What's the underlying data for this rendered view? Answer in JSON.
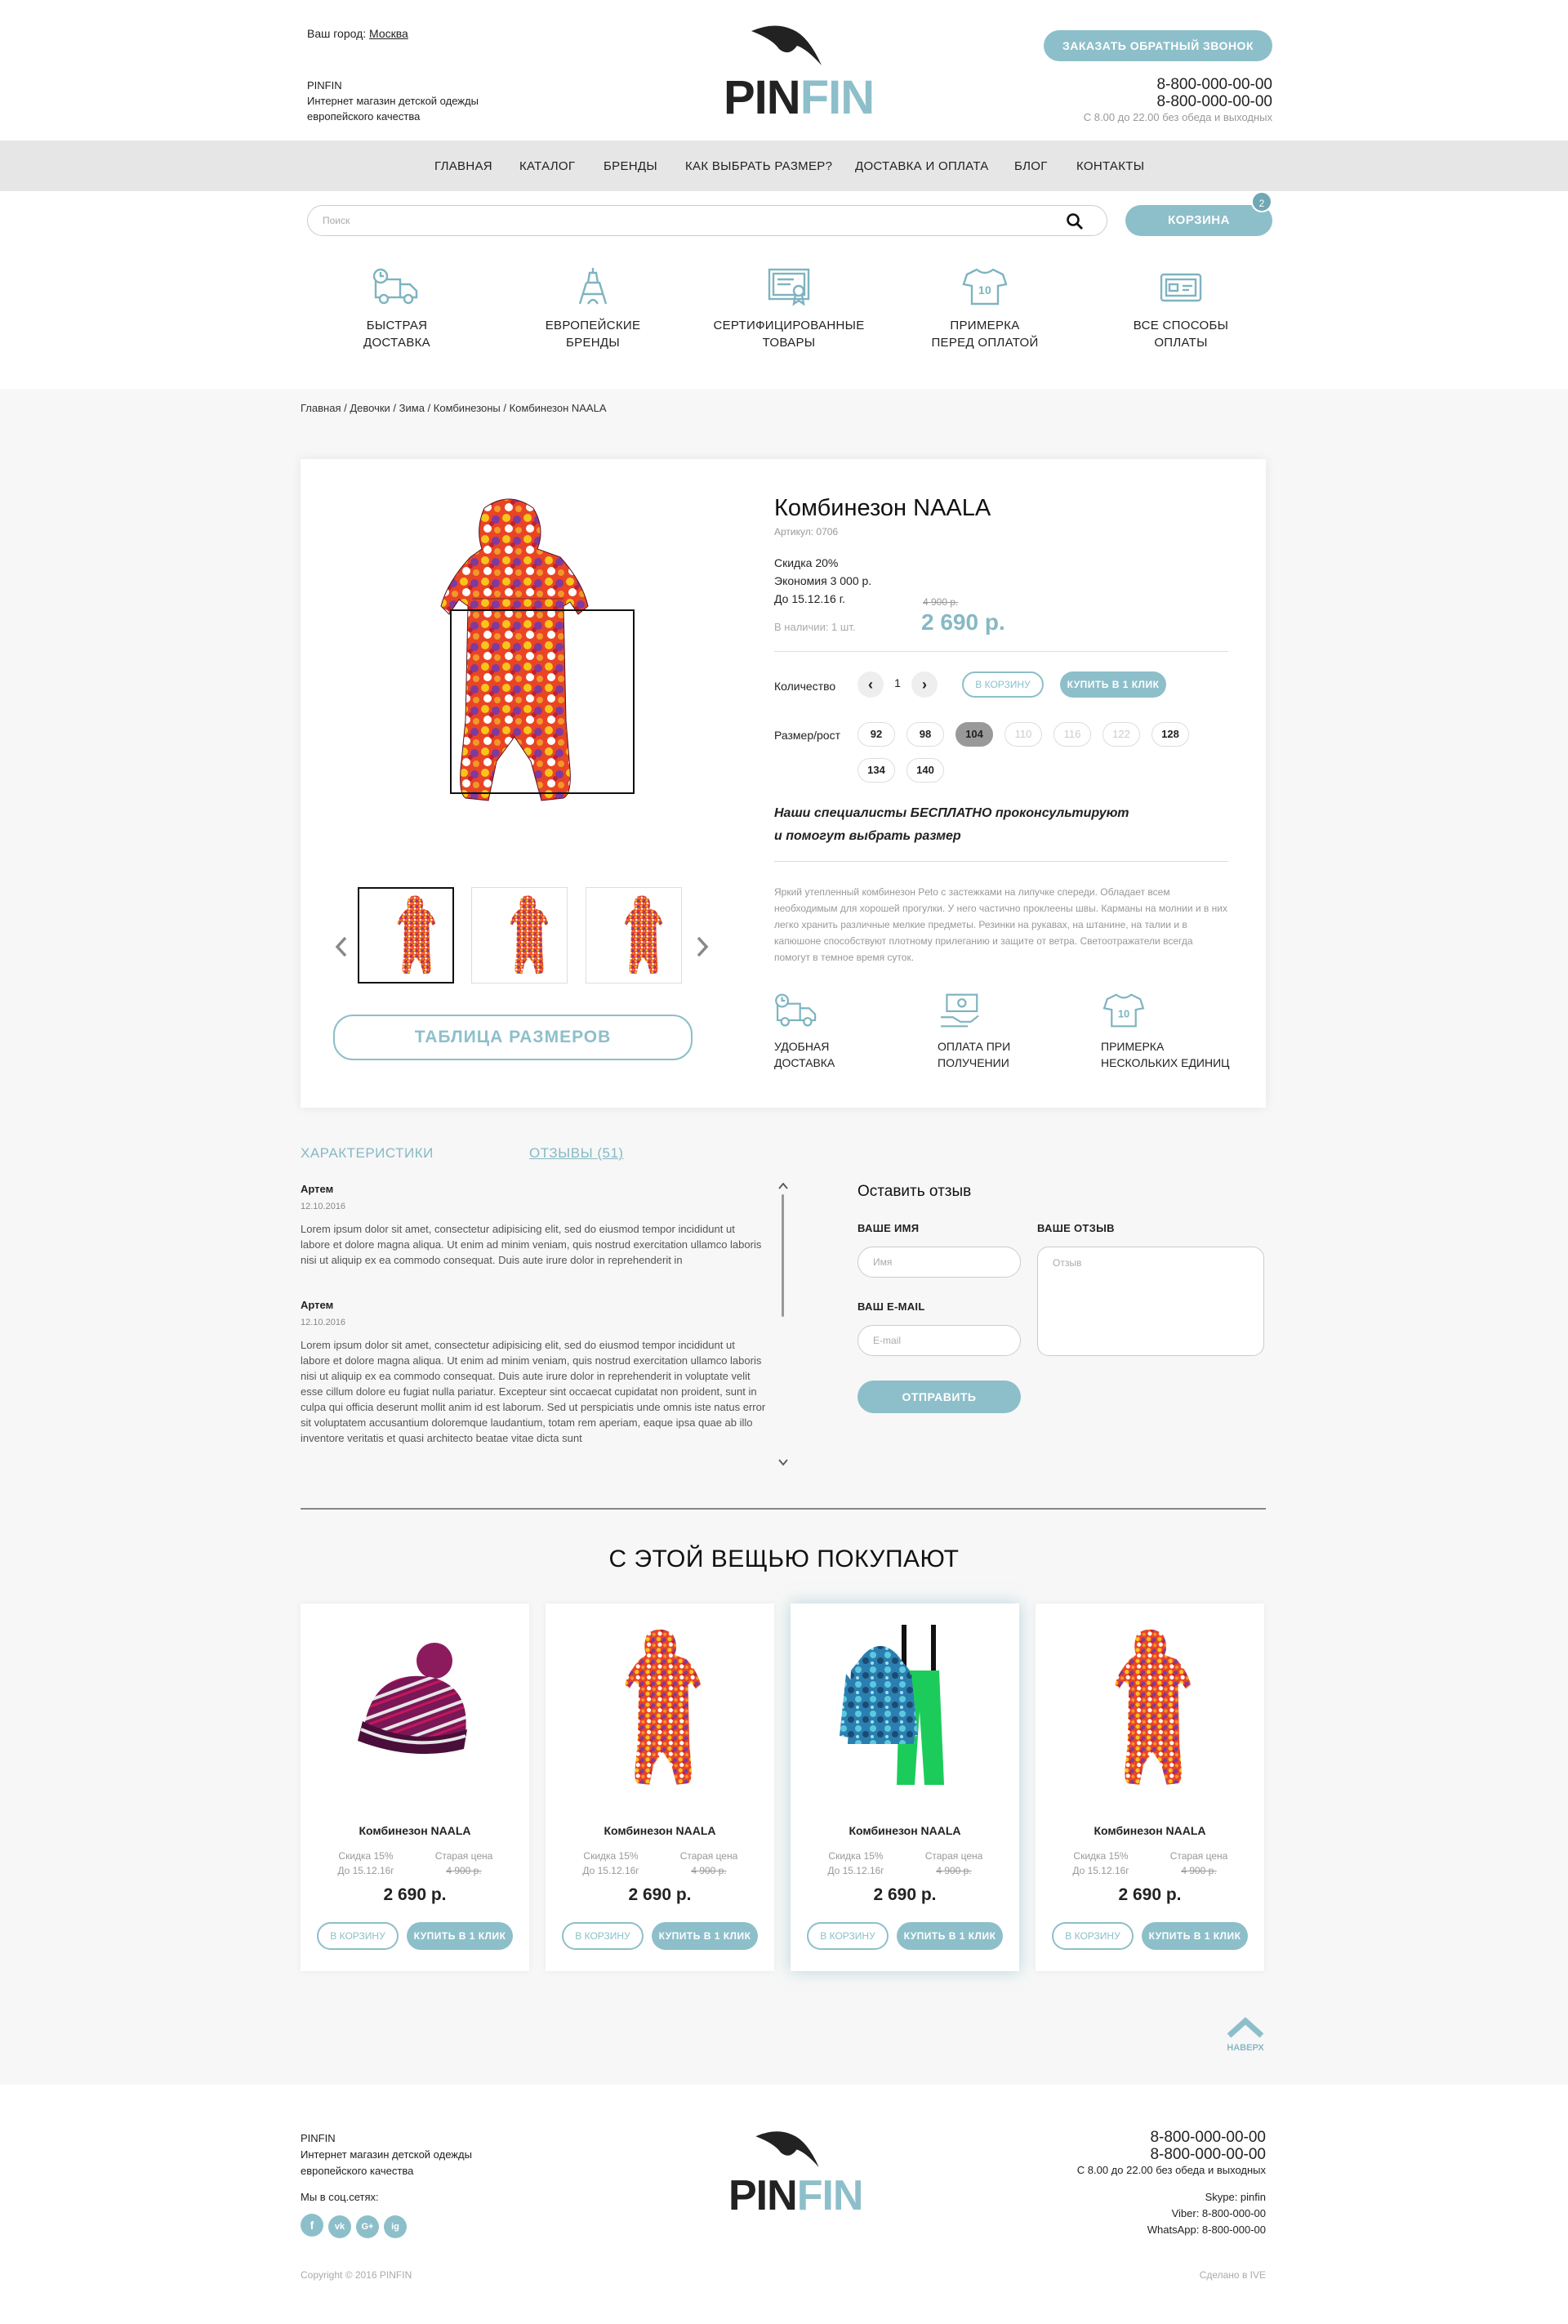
{
  "header": {
    "city_label": "Ваш город:",
    "city": "Москва",
    "brand": "PINFIN",
    "tagline_1": "Интернет магазин детской одежды",
    "tagline_2": "европейского качества",
    "logo_pin": "PIN",
    "logo_fin": "FIN",
    "callback_button": "ЗАКАЗАТЬ ОБРАТНЫЙ ЗВОНОК",
    "phone_1": "8-800-000-00-00",
    "phone_2": "8-800-000-00-00",
    "hours": "С 8.00 до 22.00 без обеда и выходных"
  },
  "nav": [
    "ГЛАВНАЯ",
    "КАТАЛОГ",
    "БРЕНДЫ",
    "КАК ВЫБРАТЬ РАЗМЕР?",
    "ДОСТАВКА И ОПЛАТА",
    "БЛОГ",
    "КОНТАКТЫ"
  ],
  "search": {
    "placeholder": "Поиск",
    "cart_label": "КОРЗИНА",
    "cart_count": "2"
  },
  "features": [
    {
      "icon": "truck-icon",
      "line1": "БЫСТРАЯ",
      "line2": "ДОСТАВКА"
    },
    {
      "icon": "eiffel-tower-icon",
      "line1": "ЕВРОПЕЙСКИЕ",
      "line2": "БРЕНДЫ"
    },
    {
      "icon": "certificate-icon",
      "line1": "СЕРТИФИЦИРОВАННЫЕ",
      "line2": "ТОВАРЫ"
    },
    {
      "icon": "tshirt-icon",
      "line1": "ПРИМЕРКА",
      "line2": "ПЕРЕД ОПЛАТОЙ"
    },
    {
      "icon": "card-icon",
      "line1": "ВСЕ СПОСОБЫ",
      "line2": "ОПЛАТЫ"
    }
  ],
  "breadcrumb": [
    "Главная",
    "Девочки",
    "Зима",
    "Комбинезоны",
    "Комбинезон NAALA"
  ],
  "breadcrumb_sep": " / ",
  "product": {
    "title": "Комбинезон NAALA",
    "article": "Артикул: 0706",
    "discount": "Скидка 20%",
    "savings": "Экономия 3 000 р.",
    "until": "До 15.12.16 г.",
    "old_price": "4 900 р.",
    "stock": "В наличии: 1 шт.",
    "price": "2 690 р.",
    "qty_label": "Количество",
    "qty": "1",
    "cart_button": "В КОРЗИНУ",
    "buy_button": "КУПИТЬ В 1 КЛИК",
    "size_label": "Размер/рост",
    "sizes": [
      {
        "v": "92",
        "state": "available"
      },
      {
        "v": "98",
        "state": "available"
      },
      {
        "v": "104",
        "state": "selected"
      },
      {
        "v": "110",
        "state": "disabled"
      },
      {
        "v": "116",
        "state": "disabled"
      },
      {
        "v": "122",
        "state": "disabled"
      },
      {
        "v": "128",
        "state": "available"
      },
      {
        "v": "134",
        "state": "available"
      },
      {
        "v": "140",
        "state": "available"
      }
    ],
    "consult_1": "Наши специалисты БЕСПЛАТНО проконсультируют",
    "consult_2": "и помогут выбрать размер",
    "description": "Яркий утепленный комбинезон Peto с застежками на липучке спереди. Обладает всем необходимым для хорошей прогулки. У него частично проклеены швы. Карманы на молнии и в них легко хранить различные мелкие предметы. Резинки на рукавах, на штанине, на талии и в капюшоне способствуют плотному прилеганию и защите от ветра. Светоотражатели всегда помогут в темное время суток.",
    "size_table_button": "ТАБЛИЦА РАЗМЕРОВ",
    "perks": [
      {
        "icon": "truck-icon",
        "line1": "УДОБНАЯ",
        "line2": "ДОСТАВКА"
      },
      {
        "icon": "cash-hand-icon",
        "line1": "ОПЛАТА ПРИ",
        "line2": "ПОЛУЧЕНИИ"
      },
      {
        "icon": "tshirt-icon",
        "line1": "ПРИМЕРКА",
        "line2": "НЕСКОЛЬКИХ ЕДИНИЦ"
      }
    ]
  },
  "tabs": {
    "characteristics": "ХАРАКТЕРИСТИКИ",
    "reviews": "ОТЗЫВЫ (51)"
  },
  "reviews": [
    {
      "name": "Артем",
      "date": "12.10.2016",
      "text": "Lorem ipsum dolor sit amet, consectetur adipisicing elit, sed do eiusmod tempor incididunt ut labore et dolore magna aliqua. Ut enim ad minim veniam, quis nostrud exercitation ullamco laboris nisi ut aliquip ex ea commodo consequat. Duis aute irure dolor in reprehenderit in"
    },
    {
      "name": "Артем",
      "date": "12.10.2016",
      "text": "Lorem ipsum dolor sit amet, consectetur adipisicing elit, sed do eiusmod tempor incididunt ut labore et dolore magna aliqua. Ut enim ad minim veniam, quis nostrud exercitation ullamco laboris nisi ut aliquip ex ea commodo consequat. Duis aute irure dolor in reprehenderit in voluptate velit esse cillum dolore eu fugiat nulla pariatur. Excepteur sint occaecat cupidatat non proident, sunt in culpa qui officia deserunt mollit anim id est laborum. Sed ut perspiciatis unde omnis iste natus error sit voluptatem accusantium doloremque laudantium, totam rem aperiam, eaque ipsa quae ab illo inventore veritatis et quasi architecto beatae vitae dicta sunt"
    }
  ],
  "review_form": {
    "title": "Оставить отзыв",
    "name_label": "ВАШЕ ИМЯ",
    "name_placeholder": "Имя",
    "review_label": "ВАШЕ ОТЗЫВ",
    "review_placeholder": "Отзыв",
    "email_label": "ВАШ E-MAIL",
    "email_placeholder": "E-mail",
    "submit": "ОТПРАВИТЬ"
  },
  "related": {
    "title": "С ЭТОЙ ВЕЩЬЮ ПОКУПАЮТ",
    "items": [
      {
        "image": "hat",
        "name": "Комбинезон NAALA",
        "discount": "Скидка 15%",
        "until": "До 15.12.16г",
        "old_label": "Старая цена",
        "old_price": "4 900 р.",
        "price": "2 690 р.",
        "cart": "В КОРЗИНУ",
        "buy": "КУПИТЬ В 1 КЛИК"
      },
      {
        "image": "suit",
        "name": "Комбинезон NAALA",
        "discount": "Скидка 15%",
        "until": "До 15.12.16г",
        "old_label": "Старая цена",
        "old_price": "4 900 р.",
        "price": "2 690 р.",
        "cart": "В КОРЗИНУ",
        "buy": "КУПИТЬ В 1 КЛИК"
      },
      {
        "image": "jacket-pants",
        "name": "Комбинезон NAALA",
        "discount": "Скидка 15%",
        "until": "До 15.12.16г",
        "old_label": "Старая цена",
        "old_price": "4 900 р.",
        "price": "2 690 р.",
        "cart": "В КОРЗИНУ",
        "buy": "КУПИТЬ В 1 КЛИК"
      },
      {
        "image": "suit",
        "name": "Комбинезон NAALA",
        "discount": "Скидка 15%",
        "until": "До 15.12.16г",
        "old_label": "Старая цена",
        "old_price": "4 900 р.",
        "price": "2 690 р.",
        "cart": "В КОРЗИНУ",
        "buy": "КУПИТЬ В 1 КЛИК"
      }
    ]
  },
  "to_top": "НАВЕРХ",
  "footer": {
    "brand": "PINFIN",
    "tagline_1": "Интернет магазин детской одежды",
    "tagline_2": "европейского качества",
    "social_label": "Мы в соц.сетях:",
    "socials": [
      "f",
      "vk",
      "G+",
      "ig"
    ],
    "copyright": "Copyright © 2016 PINFIN",
    "phone_1": "8-800-000-00-00",
    "phone_2": "8-800-000-00-00",
    "hours": "С 8.00 до 22.00 без обеда и выходных",
    "skype": "Skype: pinfin",
    "viber": "Viber: 8-800-000-00",
    "whatsapp": "WhatsApp: 8-800-000-00",
    "made_by": "Сделано в IVE"
  },
  "colors": {
    "accent": "#8dbfca",
    "text": "#222222",
    "nav_bg": "#e6e6e6",
    "page_bg": "#f7f7f7"
  }
}
